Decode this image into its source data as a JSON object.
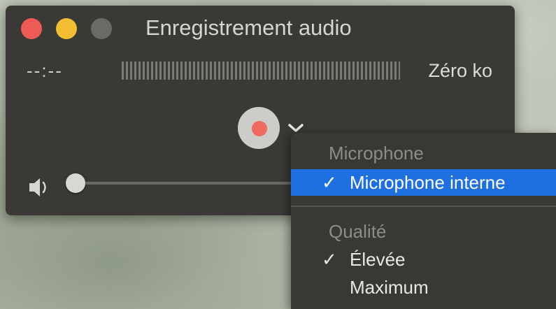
{
  "window": {
    "title": "Enregistrement audio",
    "time": "--:--",
    "file_size": "Zéro ko",
    "volume_level": 0.0
  },
  "menu": {
    "microphone_header": "Microphone",
    "microphone_items": [
      {
        "label": "Microphone interne",
        "check": "✓",
        "selected": true
      }
    ],
    "quality_header": "Qualité",
    "quality_items": [
      {
        "label": "Élevée",
        "check": "✓"
      },
      {
        "label": "Maximum",
        "check": ""
      }
    ]
  },
  "colors": {
    "close": "#ee5a56",
    "minimize": "#f4be33",
    "zoom": "#6b6a67",
    "record": "#ef6a5e",
    "selection": "#1e6fe0"
  },
  "icons": [
    "record-icon",
    "chevron-down-icon",
    "speaker-icon",
    "checkmark-icon"
  ]
}
